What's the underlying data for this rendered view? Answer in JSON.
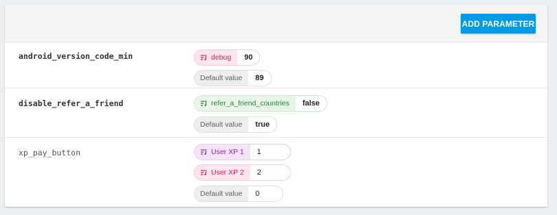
{
  "toolbar": {
    "add_label": "ADD PARAMETER"
  },
  "colors": {
    "accent": "#039be5",
    "pink": "#d81b60",
    "green": "#2e7d32",
    "purple": "#8e24aa"
  },
  "parameters": [
    {
      "name": "android_version_code_min",
      "conditions": [
        {
          "label": "debug",
          "value": "90",
          "icon": "condition-icon"
        }
      ],
      "default": {
        "label": "Default value",
        "value": "89"
      }
    },
    {
      "name": "disable_refer_a_friend",
      "conditions": [
        {
          "label": "refer_a_friend_countries",
          "value": "false",
          "icon": "condition-icon"
        }
      ],
      "default": {
        "label": "Default value",
        "value": "true"
      }
    },
    {
      "name": "xp_pay_button",
      "conditions": [
        {
          "label": "User XP 1",
          "value": "1",
          "icon": "condition-icon"
        },
        {
          "label": "User XP 2",
          "value": "2",
          "icon": "condition-icon"
        }
      ],
      "default": {
        "label": "Default value",
        "value": "0"
      }
    }
  ]
}
